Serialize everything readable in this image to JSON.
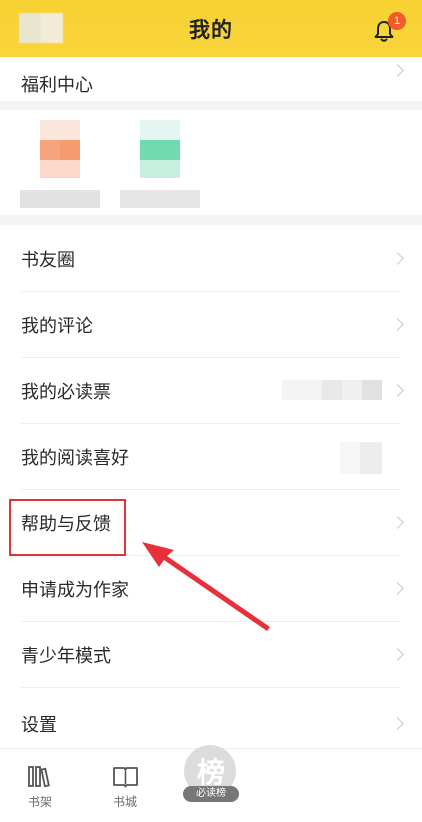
{
  "header": {
    "title": "我的",
    "notification_count": "1"
  },
  "welfare": {
    "label": "福利中心"
  },
  "menu": {
    "items": [
      {
        "label": "书友圈"
      },
      {
        "label": "我的评论"
      },
      {
        "label": "我的必读票"
      },
      {
        "label": "我的阅读喜好"
      },
      {
        "label": "帮助与反馈"
      },
      {
        "label": "申请成为作家"
      },
      {
        "label": "青少年模式"
      },
      {
        "label": "设置"
      }
    ]
  },
  "tabbar": {
    "tabs": [
      {
        "label": "书架",
        "icon": "bookshelf-icon"
      },
      {
        "label": "书城",
        "icon": "book-icon"
      }
    ],
    "center": {
      "glyph": "榜",
      "label": "必读榜"
    }
  },
  "colors": {
    "header_bg": "#f7d232",
    "badge": "#f25a26",
    "highlight": "#e0343d"
  }
}
